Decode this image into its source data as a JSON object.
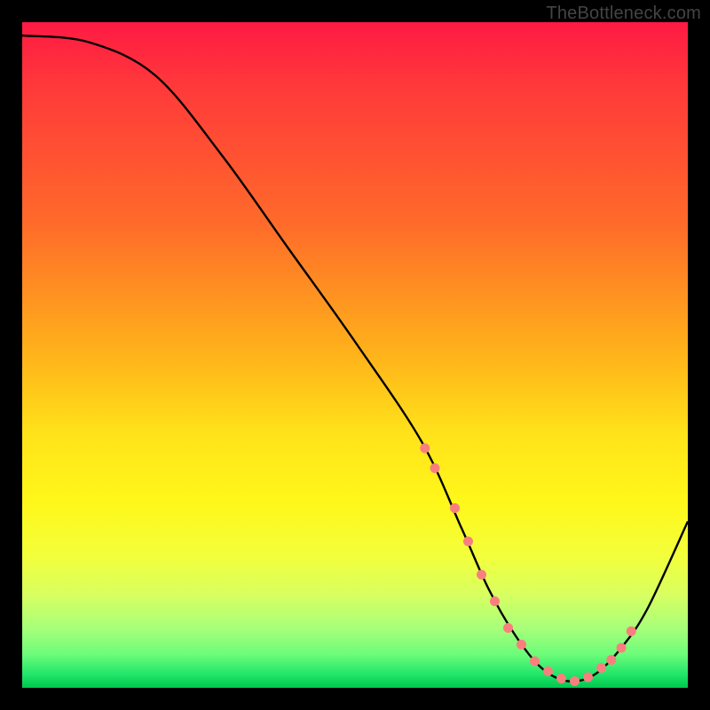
{
  "watermark": "TheBottleneck.com",
  "chart_data": {
    "type": "line",
    "title": "",
    "xlabel": "",
    "ylabel": "",
    "xlim": [
      0,
      100
    ],
    "ylim": [
      0,
      100
    ],
    "x": [
      0,
      10,
      20,
      30,
      40,
      50,
      60,
      66,
      70,
      74,
      78,
      82,
      86,
      90,
      94,
      100
    ],
    "values": [
      98,
      97,
      92,
      80,
      66,
      52,
      37,
      24,
      15,
      8,
      3,
      1,
      2,
      6,
      12,
      25
    ],
    "markers": {
      "x": [
        60.5,
        62,
        65,
        67,
        69,
        71,
        73,
        75,
        77,
        79,
        81,
        83,
        85,
        87,
        88.5,
        90,
        91.5
      ],
      "values": [
        36,
        33,
        27,
        22,
        17,
        13,
        9,
        6.5,
        4,
        2.5,
        1.4,
        1,
        1.6,
        3,
        4.2,
        6,
        8.5
      ]
    },
    "marker_color": "#f97f7f",
    "line_color": "#000000",
    "background_gradient": {
      "stops": [
        {
          "pos": 0.0,
          "color": "#ff1a44"
        },
        {
          "pos": 0.5,
          "color": "#ffb31a"
        },
        {
          "pos": 0.72,
          "color": "#fff71a"
        },
        {
          "pos": 1.0,
          "color": "#00c84e"
        }
      ]
    }
  }
}
